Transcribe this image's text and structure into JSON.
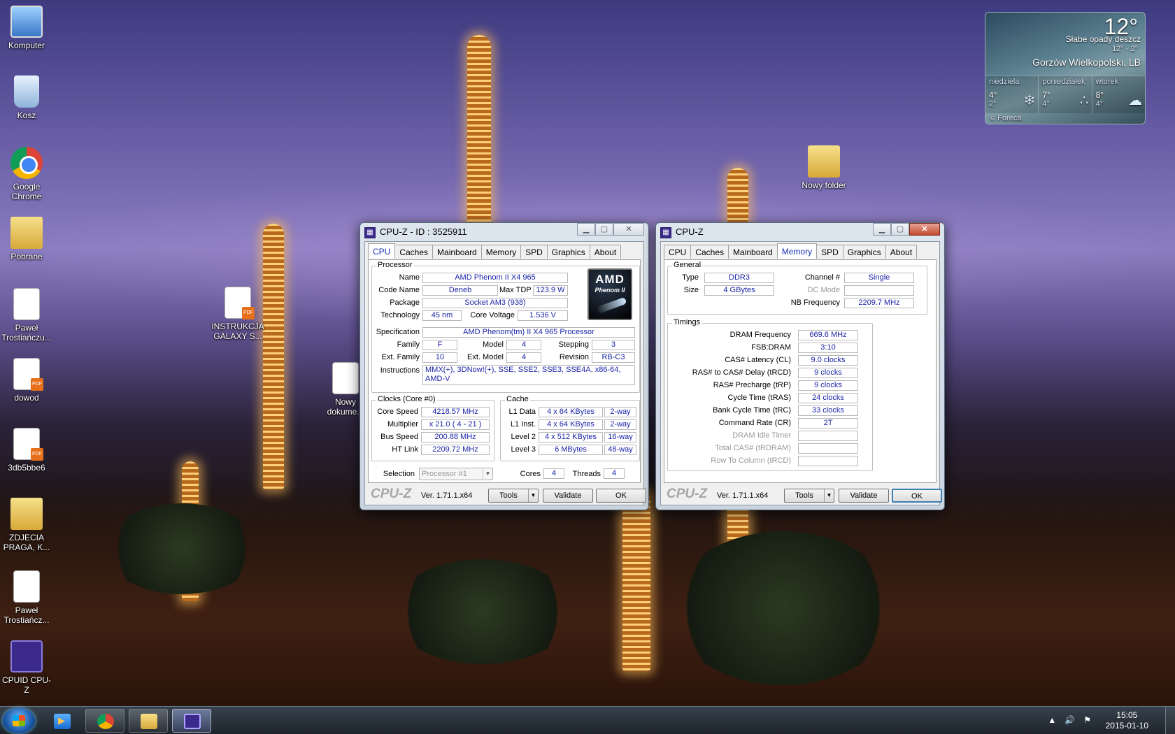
{
  "desktop": {
    "icons": [
      {
        "label": "Komputer"
      },
      {
        "label": "Kosz"
      },
      {
        "label": "Google Chrome"
      },
      {
        "label": "Pobrane"
      },
      {
        "label": "Paweł Trostiańczu..."
      },
      {
        "label": "dowod"
      },
      {
        "label": "3db5bbe6"
      },
      {
        "label": "ZDJECIA PRAGA, K..."
      },
      {
        "label": "Paweł Trostiańcz..."
      },
      {
        "label": "CPUID CPU-Z"
      },
      {
        "label": "INSTRUKCJA GALAXY S..."
      },
      {
        "label": "Nowy dokume..."
      },
      {
        "label": "Nowy folder"
      }
    ]
  },
  "weather": {
    "temp": "12°",
    "condition": "Słabe opady deszcz",
    "range": "12° - 2°",
    "city": "Gorzów Wielkopolski, LB",
    "days": [
      {
        "name": "niedziela",
        "hi": "4°",
        "lo": "2°",
        "icon": "snow-icon"
      },
      {
        "name": "poniedziałek",
        "hi": "7°",
        "lo": "4°",
        "icon": "rain-icon"
      },
      {
        "name": "wtorek",
        "hi": "8°",
        "lo": "4°",
        "icon": "cloud-icon"
      }
    ],
    "credit": "© Foreca"
  },
  "cpuz_cpu": {
    "title": "CPU-Z - ID : 3525911",
    "tabs": [
      "CPU",
      "Caches",
      "Mainboard",
      "Memory",
      "SPD",
      "Graphics",
      "About"
    ],
    "active_tab": "CPU",
    "processor_group": "Processor",
    "labels": {
      "name": "Name",
      "code_name": "Code Name",
      "max_tdp": "Max TDP",
      "package": "Package",
      "technology": "Technology",
      "core_voltage": "Core Voltage",
      "specification": "Specification",
      "family": "Family",
      "model": "Model",
      "stepping": "Stepping",
      "ext_family": "Ext. Family",
      "ext_model": "Ext. Model",
      "revision": "Revision",
      "instructions": "Instructions"
    },
    "values": {
      "name": "AMD Phenom II X4 965",
      "code_name": "Deneb",
      "max_tdp": "123.9 W",
      "package": "Socket AM3 (938)",
      "technology": "45 nm",
      "core_voltage": "1.536 V",
      "specification": "AMD Phenom(tm) II X4 965 Processor",
      "family": "F",
      "model": "4",
      "stepping": "3",
      "ext_family": "10",
      "ext_model": "4",
      "revision": "RB-C3",
      "instructions": "MMX(+), 3DNow!(+), SSE, SSE2, SSE3, SSE4A, x86-64, AMD-V"
    },
    "logo": {
      "line1": "AMD",
      "line2": "Phenom II"
    },
    "clocks": {
      "group": "Clocks (Core #0)",
      "core_speed_label": "Core Speed",
      "core_speed": "4218.57 MHz",
      "multiplier_label": "Multiplier",
      "multiplier": "x 21.0 ( 4 - 21 )",
      "bus_speed_label": "Bus Speed",
      "bus_speed": "200.88 MHz",
      "ht_link_label": "HT Link",
      "ht_link": "2209.72 MHz"
    },
    "cache": {
      "group": "Cache",
      "rows": [
        {
          "label": "L1 Data",
          "size": "4 x 64 KBytes",
          "way": "2-way"
        },
        {
          "label": "L1 Inst.",
          "size": "4 x 64 KBytes",
          "way": "2-way"
        },
        {
          "label": "Level 2",
          "size": "4 x 512 KBytes",
          "way": "16-way"
        },
        {
          "label": "Level 3",
          "size": "6 MBytes",
          "way": "48-way"
        }
      ]
    },
    "selection": {
      "label": "Selection",
      "value": "Processor #1",
      "cores_label": "Cores",
      "cores": "4",
      "threads_label": "Threads",
      "threads": "4"
    },
    "footer": {
      "brand": "CPU-Z",
      "version": "Ver. 1.71.1.x64",
      "tools": "Tools",
      "validate": "Validate",
      "ok": "OK"
    }
  },
  "cpuz_mem": {
    "title": "CPU-Z",
    "tabs": [
      "CPU",
      "Caches",
      "Mainboard",
      "Memory",
      "SPD",
      "Graphics",
      "About"
    ],
    "active_tab": "Memory",
    "general": {
      "group": "General",
      "type_label": "Type",
      "type": "DDR3",
      "size_label": "Size",
      "size": "4 GBytes",
      "channel_label": "Channel #",
      "channel": "Single",
      "dc_mode_label": "DC Mode",
      "dc_mode": "",
      "nb_freq_label": "NB Frequency",
      "nb_freq": "2209.7 MHz"
    },
    "timings": {
      "group": "Timings",
      "rows": [
        {
          "label": "DRAM Frequency",
          "value": "669.6 MHz",
          "enabled": true
        },
        {
          "label": "FSB:DRAM",
          "value": "3:10",
          "enabled": true
        },
        {
          "label": "CAS# Latency (CL)",
          "value": "9.0 clocks",
          "enabled": true
        },
        {
          "label": "RAS# to CAS# Delay (tRCD)",
          "value": "9 clocks",
          "enabled": true
        },
        {
          "label": "RAS# Precharge (tRP)",
          "value": "9 clocks",
          "enabled": true
        },
        {
          "label": "Cycle Time (tRAS)",
          "value": "24 clocks",
          "enabled": true
        },
        {
          "label": "Bank Cycle Time (tRC)",
          "value": "33 clocks",
          "enabled": true
        },
        {
          "label": "Command Rate (CR)",
          "value": "2T",
          "enabled": true
        },
        {
          "label": "DRAM Idle Timer",
          "value": "",
          "enabled": false
        },
        {
          "label": "Total CAS# (tRDRAM)",
          "value": "",
          "enabled": false
        },
        {
          "label": "Row To Column (tRCD)",
          "value": "",
          "enabled": false
        }
      ]
    },
    "footer": {
      "brand": "CPU-Z",
      "version": "Ver. 1.71.1.x64",
      "tools": "Tools",
      "validate": "Validate",
      "ok": "OK"
    }
  },
  "taskbar": {
    "clock_time": "15:05",
    "clock_date": "2015-01-10",
    "tray": {
      "up_arrow": "▲",
      "volume": "🔊",
      "flag": "⚑"
    }
  }
}
